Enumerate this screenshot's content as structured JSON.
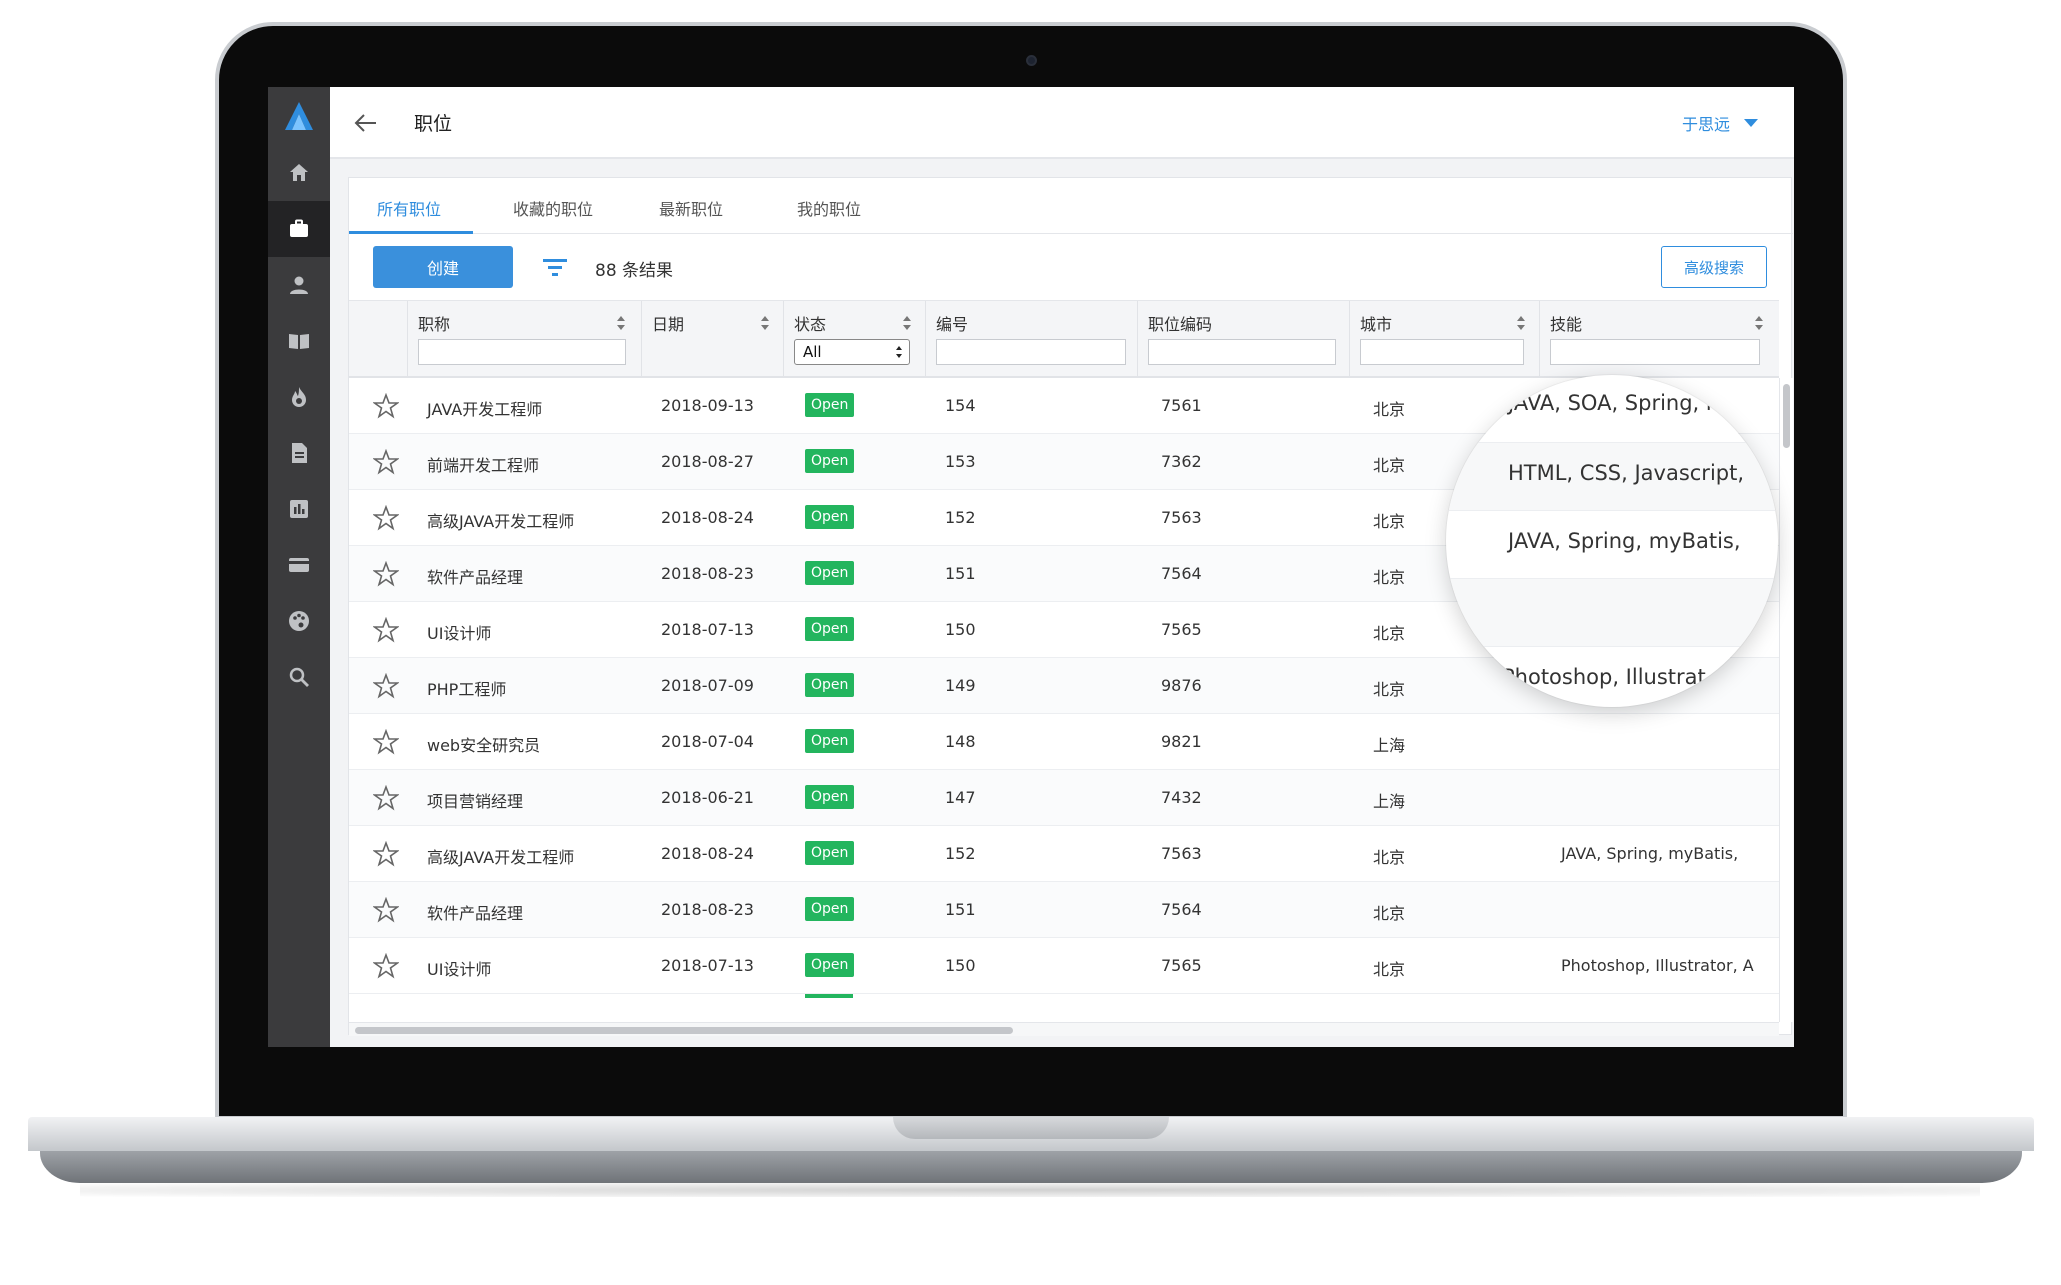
{
  "header": {
    "title": "职位",
    "user": "于思远"
  },
  "tabs": [
    "所有职位",
    "收藏的职位",
    "最新职位",
    "我的职位"
  ],
  "toolbar": {
    "create_label": "创建",
    "result_count": "88 条结果",
    "advanced_search_label": "高级搜索"
  },
  "table": {
    "columns": [
      "职称",
      "日期",
      "状态",
      "编号",
      "职位编码",
      "城市",
      "技能"
    ],
    "status_filter": "All",
    "rows": [
      {
        "title": "JAVA开发工程师",
        "date": "2018-09-13",
        "status": "Open",
        "no": "154",
        "code": "7561",
        "city": "北京",
        "skills": ""
      },
      {
        "title": "前端开发工程师",
        "date": "2018-08-27",
        "status": "Open",
        "no": "153",
        "code": "7362",
        "city": "北京",
        "skills": ""
      },
      {
        "title": "高级JAVA开发工程师",
        "date": "2018-08-24",
        "status": "Open",
        "no": "152",
        "code": "7563",
        "city": "北京",
        "skills": ""
      },
      {
        "title": "软件产品经理",
        "date": "2018-08-23",
        "status": "Open",
        "no": "151",
        "code": "7564",
        "city": "北京",
        "skills": ""
      },
      {
        "title": "UI设计师",
        "date": "2018-07-13",
        "status": "Open",
        "no": "150",
        "code": "7565",
        "city": "北京",
        "skills": ""
      },
      {
        "title": "PHP工程师",
        "date": "2018-07-09",
        "status": "Open",
        "no": "149",
        "code": "9876",
        "city": "北京",
        "skills": ""
      },
      {
        "title": "web安全研究员",
        "date": "2018-07-04",
        "status": "Open",
        "no": "148",
        "code": "9821",
        "city": "上海",
        "skills": ""
      },
      {
        "title": "项目营销经理",
        "date": "2018-06-21",
        "status": "Open",
        "no": "147",
        "code": "7432",
        "city": "上海",
        "skills": ""
      },
      {
        "title": "高级JAVA开发工程师",
        "date": "2018-08-24",
        "status": "Open",
        "no": "152",
        "code": "7563",
        "city": "北京",
        "skills": "JAVA, Spring, myBatis,"
      },
      {
        "title": "软件产品经理",
        "date": "2018-08-23",
        "status": "Open",
        "no": "151",
        "code": "7564",
        "city": "北京",
        "skills": ""
      },
      {
        "title": "UI设计师",
        "date": "2018-07-13",
        "status": "Open",
        "no": "150",
        "code": "7565",
        "city": "北京",
        "skills": "Photoshop, Illustrator, A"
      }
    ]
  },
  "magnifier": {
    "lines": [
      "JAVA, SOA, Spring, myB",
      "HTML, CSS, Javascript,",
      "JAVA, Spring, myBatis,",
      "",
      "Photoshop, Illustrat"
    ]
  },
  "colors": {
    "accent": "#2f8dde",
    "status_open": "#23b55e",
    "sidebar": "#3b3b3d"
  },
  "sidebar_icons": [
    "home-icon",
    "briefcase-icon",
    "person-icon",
    "book-icon",
    "flame-icon",
    "document-icon",
    "bar-chart-icon",
    "credit-card-icon",
    "palette-icon",
    "search-icon"
  ]
}
